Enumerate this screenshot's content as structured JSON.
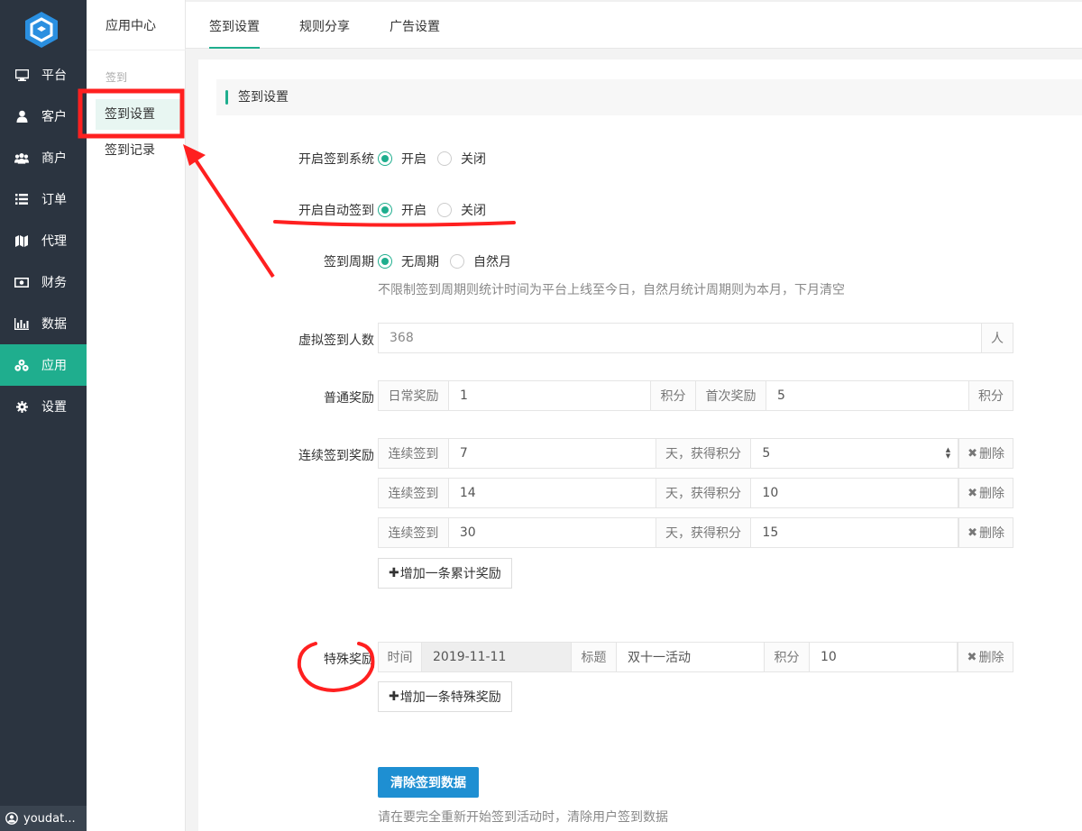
{
  "sidebar": {
    "items": [
      {
        "label": "平台",
        "icon": "monitor-icon"
      },
      {
        "label": "客户",
        "icon": "user-icon"
      },
      {
        "label": "商户",
        "icon": "users-icon"
      },
      {
        "label": "订单",
        "icon": "list-icon"
      },
      {
        "label": "代理",
        "icon": "map-icon"
      },
      {
        "label": "财务",
        "icon": "money-icon"
      },
      {
        "label": "数据",
        "icon": "bar-chart-icon"
      },
      {
        "label": "应用",
        "icon": "cubes-icon"
      },
      {
        "label": "设置",
        "icon": "gear-icon"
      }
    ],
    "active": "应用",
    "user": "youdat..."
  },
  "subpanel": {
    "title": "应用中心",
    "group": "签到",
    "items": [
      "签到设置",
      "签到记录"
    ]
  },
  "tabs": [
    "签到设置",
    "规则分享",
    "广告设置"
  ],
  "section_title": "签到设置",
  "form": {
    "enable_system": {
      "label": "开启签到系统",
      "options": [
        "开启",
        "关闭"
      ],
      "selected": "开启"
    },
    "auto_signin": {
      "label": "开启自动签到",
      "options": [
        "开启",
        "关闭"
      ],
      "selected": "开启"
    },
    "period": {
      "label": "签到周期",
      "options": [
        "无周期",
        "自然月"
      ],
      "selected": "无周期",
      "help": "不限制签到周期则统计时间为平台上线至今日，自然月统计周期则为本月，下月清空"
    },
    "virtual": {
      "label": "虚拟签到人数",
      "value": "368",
      "unit": "人"
    },
    "normal": {
      "label": "普通奖励",
      "daily_label": "日常奖励",
      "daily_value": "1",
      "unit": "积分",
      "first_label": "首次奖励",
      "first_value": "5"
    },
    "continuous": {
      "label": "连续签到奖励",
      "prefix": "连续签到",
      "middle": "天，获得积分",
      "delete": "删除",
      "rows": [
        {
          "days": "7",
          "points": "5"
        },
        {
          "days": "14",
          "points": "10"
        },
        {
          "days": "30",
          "points": "15"
        }
      ],
      "add": "增加一条累计奖励"
    },
    "special": {
      "label": "特殊奖励",
      "time_label": "时间",
      "time_value": "2019-11-11",
      "title_label": "标题",
      "title_value": "双十一活动",
      "points_label": "积分",
      "points_value": "10",
      "delete": "删除",
      "add": "增加一条特殊奖励"
    },
    "clear": {
      "button": "清除签到数据",
      "help": "请在要完全重新开始签到活动时，清除用户签到数据"
    }
  },
  "colors": {
    "accent": "#1fae8e",
    "sidebar": "#2b3440",
    "primary": "#1e8fd2",
    "annotation": "#ff2020"
  }
}
